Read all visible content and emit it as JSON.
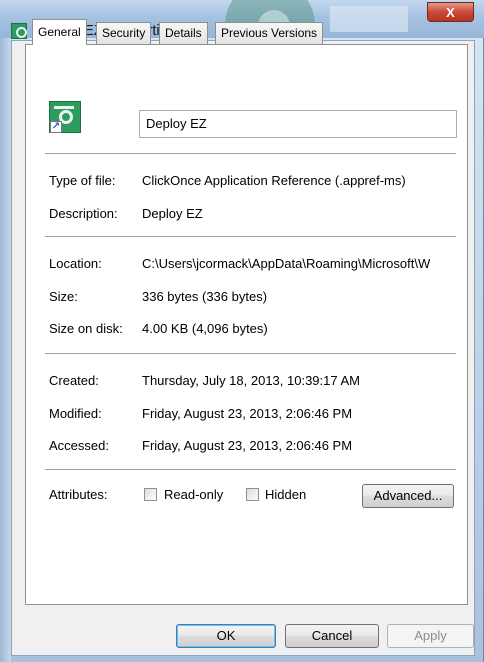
{
  "window": {
    "title": "Deploy EZ Properties",
    "close_label": "X"
  },
  "tabs": [
    {
      "label": "General",
      "active": true
    },
    {
      "label": "Security",
      "active": false
    },
    {
      "label": "Details",
      "active": false
    },
    {
      "label": "Previous Versions",
      "active": false
    }
  ],
  "file": {
    "name": "Deploy EZ",
    "icon": "clickonce-app-shortcut-icon"
  },
  "properties": {
    "type_label": "Type of file:",
    "type_value": "ClickOnce Application Reference (.appref-ms)",
    "description_label": "Description:",
    "description_value": "Deploy EZ",
    "location_label": "Location:",
    "location_value": "C:\\Users\\jcormack\\AppData\\Roaming\\Microsoft\\W",
    "size_label": "Size:",
    "size_value": "336 bytes (336 bytes)",
    "size_on_disk_label": "Size on disk:",
    "size_on_disk_value": "4.00 KB (4,096 bytes)",
    "created_label": "Created:",
    "created_value": "Thursday, July 18, 2013, 10:39:17 AM",
    "modified_label": "Modified:",
    "modified_value": "Friday, August 23, 2013, 2:06:46 PM",
    "accessed_label": "Accessed:",
    "accessed_value": "Friday, August 23, 2013, 2:06:46 PM"
  },
  "attributes": {
    "label": "Attributes:",
    "read_only_label": "Read-only",
    "hidden_label": "Hidden",
    "advanced_label": "Advanced..."
  },
  "buttons": {
    "ok": "OK",
    "cancel": "Cancel",
    "apply": "Apply"
  },
  "colors": {
    "default_button_border": "#3c7fb1",
    "close_button": "#c94a38",
    "app_icon": "#2e9c5f"
  }
}
